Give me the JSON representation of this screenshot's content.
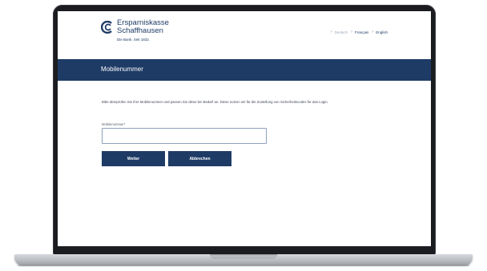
{
  "brand": {
    "name_line1": "Ersparniskasse",
    "name_line2": "Schaffhausen",
    "tagline": "Die Bank. Seit 1832."
  },
  "language_nav": {
    "items": [
      {
        "label": "Deutsch",
        "active": false
      },
      {
        "label": "Français",
        "active": true
      },
      {
        "label": "English",
        "active": true
      }
    ]
  },
  "page": {
    "title": "Mobilenummer"
  },
  "form": {
    "instruction": "Bitte überprüfen Sie Ihre Mobilenummer und passen Sie diese bei Bedarf an. Diese nutzen wir für die Zustellung von Sicherheitscodes für das Login.",
    "mobile_label": "Mobilenummer*",
    "mobile_value": "",
    "next_label": "Weiter",
    "cancel_label": "Abbrechen"
  },
  "colors": {
    "brand_navy": "#1e3b66",
    "bezel": "#1b1c1f",
    "input_border": "#8fa1bd"
  }
}
